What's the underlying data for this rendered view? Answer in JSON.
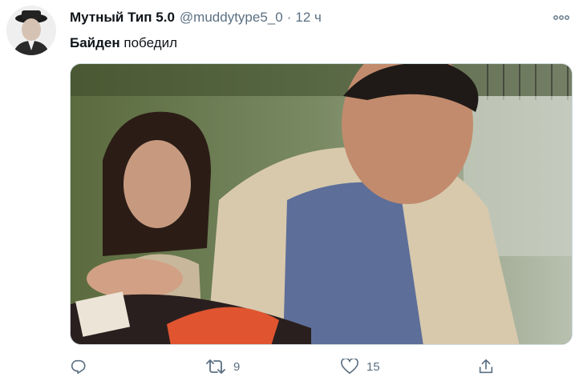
{
  "tweet": {
    "display_name": "Мутный Тип 5.0",
    "handle": "@muddytype5_0",
    "separator": "·",
    "time": "12 ч",
    "text_bold": "Байден",
    "text_rest": " победил",
    "retweet_count": "9",
    "like_count": "15"
  },
  "icons": {
    "more": "more-horizontal-icon",
    "reply": "reply-icon",
    "retweet": "retweet-icon",
    "like": "heart-icon",
    "share": "share-icon"
  },
  "colors": {
    "text_primary": "#0f1419",
    "text_secondary": "#5b7083",
    "border": "#cfd9de"
  }
}
